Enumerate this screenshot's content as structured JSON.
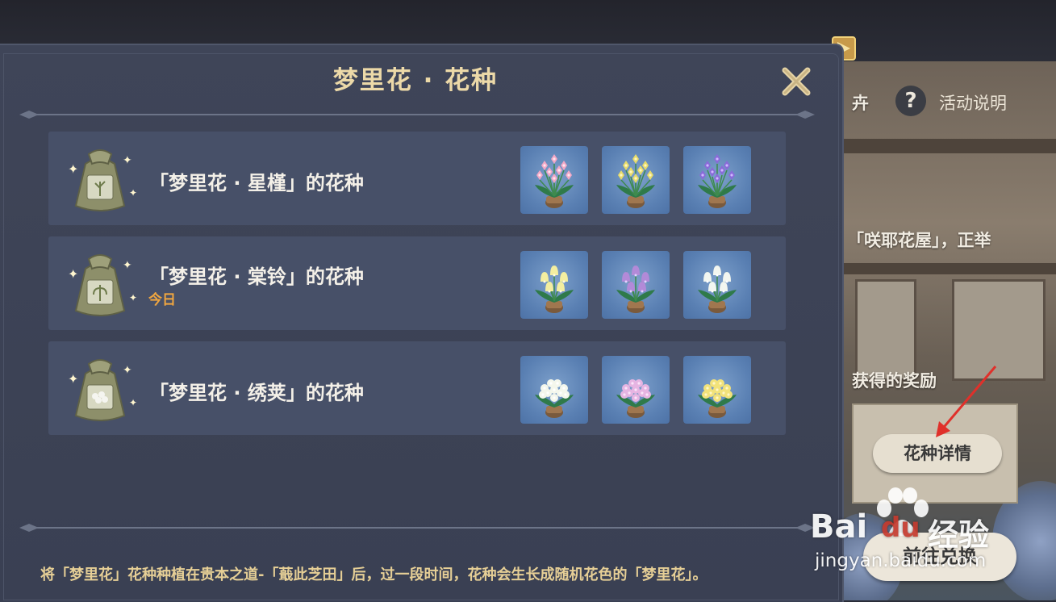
{
  "panel": {
    "title": "梦里花 · 花种",
    "footnote": "将「梦里花」花种种植在贵本之道-「蕺此芝田」后，过一段时间，花种会生长成随机花色的「梦里花」。"
  },
  "seeds": [
    {
      "name": "「梦里花 · 星槿」的花种",
      "tag": "",
      "flowers": [
        {
          "icon": "pink-star-hibiscus-icon",
          "petal": "#f2a8c6",
          "center": "#ffe6f0"
        },
        {
          "icon": "yellow-star-hibiscus-icon",
          "petal": "#e8dc6a",
          "center": "#fff6c2"
        },
        {
          "icon": "purple-star-hibiscus-icon",
          "petal": "#8a6ad8",
          "center": "#cdb8ff"
        }
      ]
    },
    {
      "name": "「梦里花 · 棠铃」的花种",
      "tag": "今日",
      "flowers": [
        {
          "icon": "yellow-bellflower-icon",
          "petal": "#f3eea0",
          "center": "#fffbe0"
        },
        {
          "icon": "purple-bellflower-icon",
          "petal": "#b28ad8",
          "center": "#e6d2ff"
        },
        {
          "icon": "white-bellflower-icon",
          "petal": "#f2f6f0",
          "center": "#ffffff"
        }
      ]
    },
    {
      "name": "「梦里花 · 绣荚」的花种",
      "tag": "",
      "flowers": [
        {
          "icon": "white-hydrangea-icon",
          "petal": "#f4f7ec",
          "center": "#ffffff"
        },
        {
          "icon": "pink-hydrangea-icon",
          "petal": "#e6b4e2",
          "center": "#fbe4fa"
        },
        {
          "icon": "yellow-hydrangea-icon",
          "petal": "#f2e27a",
          "center": "#fff7c6"
        }
      ]
    }
  ],
  "background": {
    "partial_text_1": "卉",
    "help_label": "活动说明",
    "partial_text_2": "「咲耶花屋」，正举",
    "partial_text_3": "获得的奖励",
    "seed_detail_button": "花种详情",
    "goto_exchange_button": "前往兑换"
  },
  "watermark": {
    "brand": "Bai",
    "brand_suffix": "du",
    "product": "经验",
    "url": "jingyan.baidu.com"
  },
  "colors": {
    "panel_bg": "#3f4558",
    "row_bg": "#475068",
    "title_gold": "#ecd9a8",
    "tag_orange": "#f0a640",
    "annotation_red": "#e0302a"
  }
}
